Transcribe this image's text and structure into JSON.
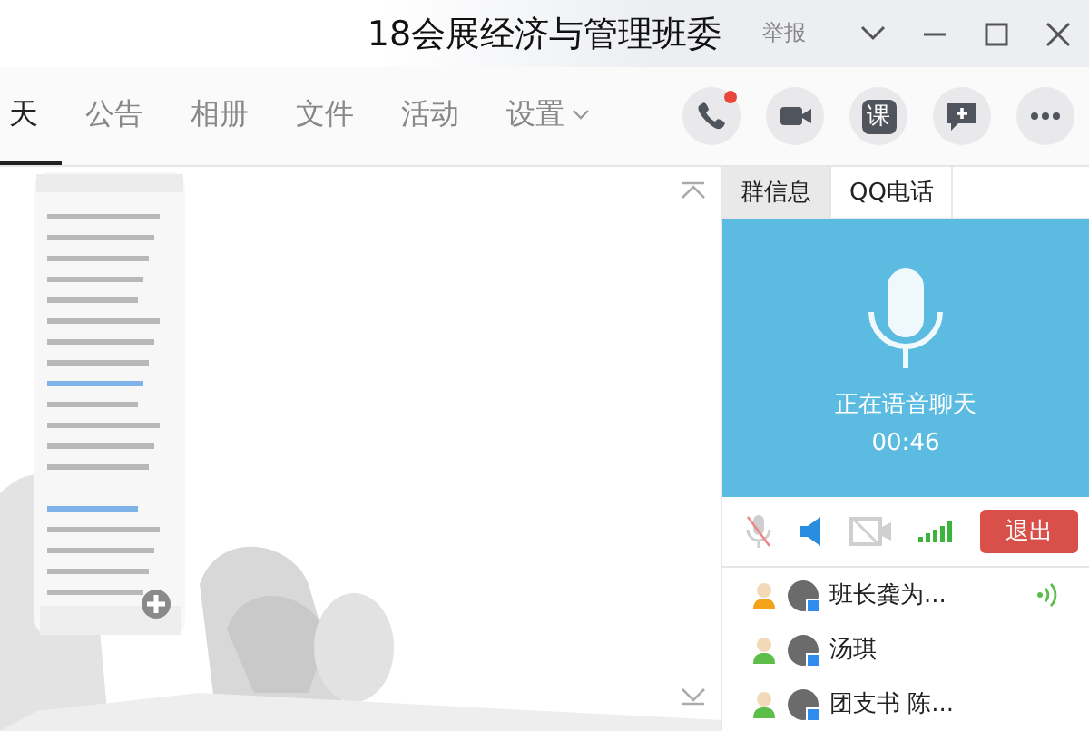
{
  "window": {
    "title": "18会展经济与管理班委",
    "report": "举报"
  },
  "tabs": [
    {
      "label": "天",
      "selected": true,
      "kind": "tab"
    },
    {
      "label": "公告",
      "selected": false,
      "kind": "tab"
    },
    {
      "label": "相册",
      "selected": false,
      "kind": "tab"
    },
    {
      "label": "文件",
      "selected": false,
      "kind": "tab"
    },
    {
      "label": "活动",
      "selected": false,
      "kind": "tab"
    },
    {
      "label": "设置",
      "selected": false,
      "kind": "menu"
    }
  ],
  "toolbar": [
    {
      "kind": "phone",
      "badge": true
    },
    {
      "kind": "video",
      "badge": false
    },
    {
      "kind": "course",
      "label": "课",
      "badge": false
    },
    {
      "kind": "chat-add",
      "badge": false
    },
    {
      "kind": "more",
      "badge": false
    }
  ],
  "side_tabs": [
    {
      "label": "群信息",
      "selected": false
    },
    {
      "label": "QQ电话",
      "selected": true
    }
  ],
  "call": {
    "status": "正在语音聊天",
    "duration": "00:46",
    "mic_muted": true,
    "speaker_on": true,
    "camera_on": false,
    "leave": "退出"
  },
  "members": [
    {
      "name": "班长龚为...",
      "color": "#f5a21b",
      "speaking": true
    },
    {
      "name": "汤琪",
      "color": "#5cbd48",
      "speaking": false
    },
    {
      "name": "团支书 陈...",
      "color": "#5cbd48",
      "speaking": false
    }
  ]
}
